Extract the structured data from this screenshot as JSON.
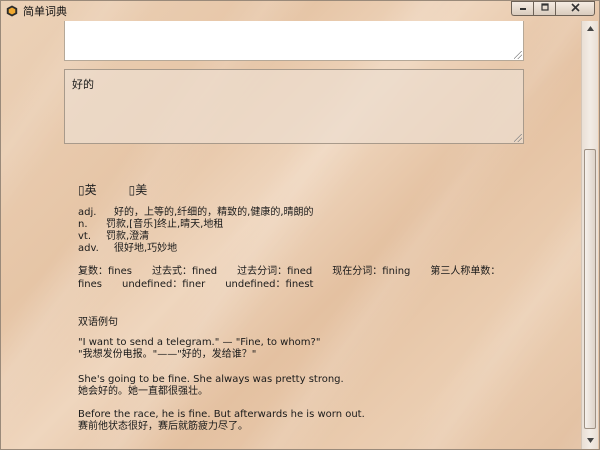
{
  "window": {
    "title": "简单词典"
  },
  "icons": {
    "app": "dictionary-app-icon",
    "minimize": "minimize-icon",
    "maximize": "maximize-icon",
    "close": "close-icon"
  },
  "input": {
    "value": ""
  },
  "output": {
    "translation": "好的"
  },
  "phonetics": {
    "uk_label": "英",
    "us_label": "美"
  },
  "definitions": [
    {
      "pos": "adj.",
      "text": "好的，上等的,纤细的，精致的,健康的,晴朗的"
    },
    {
      "pos": "n.",
      "text": "罚款,[音乐]终止,晴天,地租"
    },
    {
      "pos": "vt.",
      "text": "罚款,澄清"
    },
    {
      "pos": "adv.",
      "text": "很好地,巧妙地"
    }
  ],
  "forms": {
    "plural": "复数：fines",
    "past": "过去式：fined",
    "past_participle": "过去分词：fined",
    "present_participle": "现在分词：fining",
    "third_person": "第三人称单数：",
    "third_person_value": "fines",
    "comparative": "undefined：finer",
    "superlative": "undefined：finest"
  },
  "examples": {
    "heading": "双语例句",
    "items": [
      {
        "en": "\"I want to send a telegram.\" — \"Fine, to whom?\"",
        "zh": "\"我想发份电报。\"——\"好的，发给谁？\""
      },
      {
        "en": "She's going to be fine. She always was pretty strong.",
        "zh": "她会好的。她一直都很强壮。"
      },
      {
        "en": "Before the race, he is fine. But afterwards he is worn out.",
        "zh": "赛前他状态很好，赛后就筋疲力尽了。"
      }
    ]
  }
}
